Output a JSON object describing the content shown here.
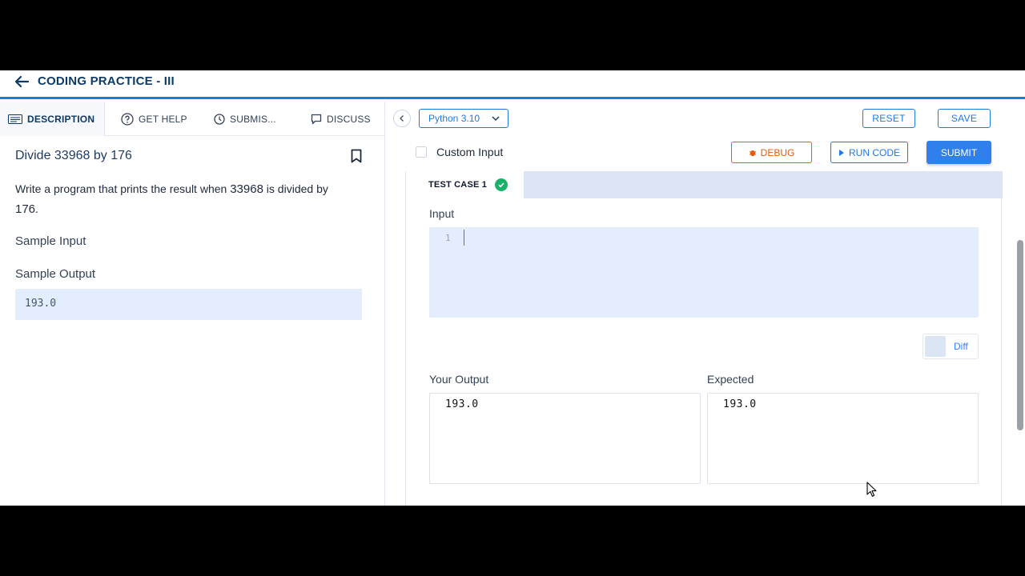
{
  "header": {
    "title": "CODING PRACTICE - III"
  },
  "tabs": [
    {
      "label": "DESCRIPTION",
      "icon": "description-icon",
      "active": true
    },
    {
      "label": "GET HELP",
      "icon": "help-circle-icon"
    },
    {
      "label": "SUBMIS...",
      "icon": "clock-icon"
    },
    {
      "label": "DISCUSS",
      "icon": "chat-icon"
    }
  ],
  "question": {
    "title": "Divide 33968 by 176",
    "desc_prefix": "Write a program that prints the result when ",
    "num1": "33968",
    "desc_mid": " is divided by",
    "num2": "176",
    "desc_suffix": ".",
    "sample_input_label": "Sample Input",
    "sample_output_label": "Sample Output",
    "sample_output": "193.0"
  },
  "editor_toolbar": {
    "language": "Python 3.10",
    "reset": "RESET",
    "save": "SAVE",
    "custom_input": "Custom Input",
    "debug": "DEBUG",
    "run_code": "RUN CODE",
    "submit": "SUBMIT"
  },
  "testcase": {
    "tab_label": "TEST CASE 1",
    "status": "passed",
    "input_label": "Input",
    "line_number": "1",
    "diff_label": "Diff",
    "your_output_label": "Your Output",
    "expected_label": "Expected",
    "your_output": "193.0",
    "expected_output": "193.0"
  },
  "colors": {
    "accent": "#1f7ae0",
    "debug": "#e8590c",
    "success": "#17b26a",
    "title": "#0d3b66"
  }
}
